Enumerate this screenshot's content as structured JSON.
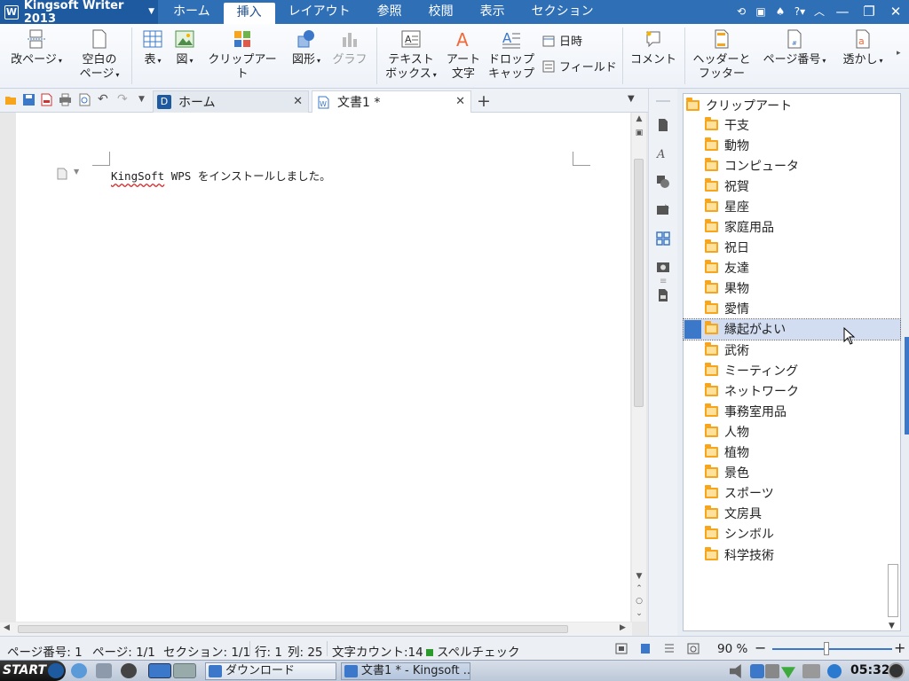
{
  "app": {
    "title": "Kingsoft Writer 2013",
    "logo_letter": "W",
    "menu_tabs": [
      "ホーム",
      "挿入",
      "レイアウト",
      "参照",
      "校閲",
      "表示",
      "セクション"
    ],
    "active_tab": "挿入"
  },
  "ribbon": {
    "page_break": "改ページ",
    "blank_page_line1": "空白の",
    "blank_page_line2": "ページ",
    "table": "表",
    "picture": "図",
    "clipart": "クリップアート",
    "shapes": "図形",
    "chart": "グラフ",
    "textbox_line1": "テキスト",
    "textbox_line2": "ボックス",
    "wordart_line1": "アート",
    "wordart_line2": "文字",
    "dropcap_line1": "ドロップ",
    "dropcap_line2": "キャップ",
    "datetime": "日時",
    "field": "フィールド",
    "comment": "コメント",
    "header_footer_line1": "ヘッダーと",
    "header_footer_line2": "フッター",
    "page_number": "ページ番号",
    "watermark": "透かし"
  },
  "tabs": {
    "home_tab": "ホーム",
    "doc_tab": "文書1 *"
  },
  "document": {
    "text_spellcheck": "KingSoft",
    "text_rest": " WPS をインストールしました。"
  },
  "clipart_panel": {
    "root": "クリップアート",
    "items": [
      "干支",
      "動物",
      "コンピュータ",
      "祝賀",
      "星座",
      "家庭用品",
      "祝日",
      "友達",
      "果物",
      "愛情",
      "縁起がよい",
      "武術",
      "ミーティング",
      "ネットワーク",
      "事務室用品",
      "人物",
      "植物",
      "景色",
      "スポーツ",
      "文房具",
      "シンボル",
      "科学技術"
    ],
    "selected": "縁起がよい"
  },
  "status": {
    "page_number": "ページ番号: 1",
    "page": "ページ: 1/1",
    "section": "セクション: 1/1",
    "row": "行: 1",
    "col": "列: 25",
    "char_count": "文字カウント:14",
    "spell_check": "スペルチェック",
    "zoom": "90 %",
    "zoom_fraction": 0.45
  },
  "taskbar": {
    "start": "START",
    "task_download": "ダウンロード",
    "task_writer": "文書1 * - Kingsoft ...",
    "clock": "05:32"
  },
  "colors": {
    "accent": "#2f6fb6",
    "folder": "#f7a51c",
    "selection": "#d2ddf1"
  }
}
